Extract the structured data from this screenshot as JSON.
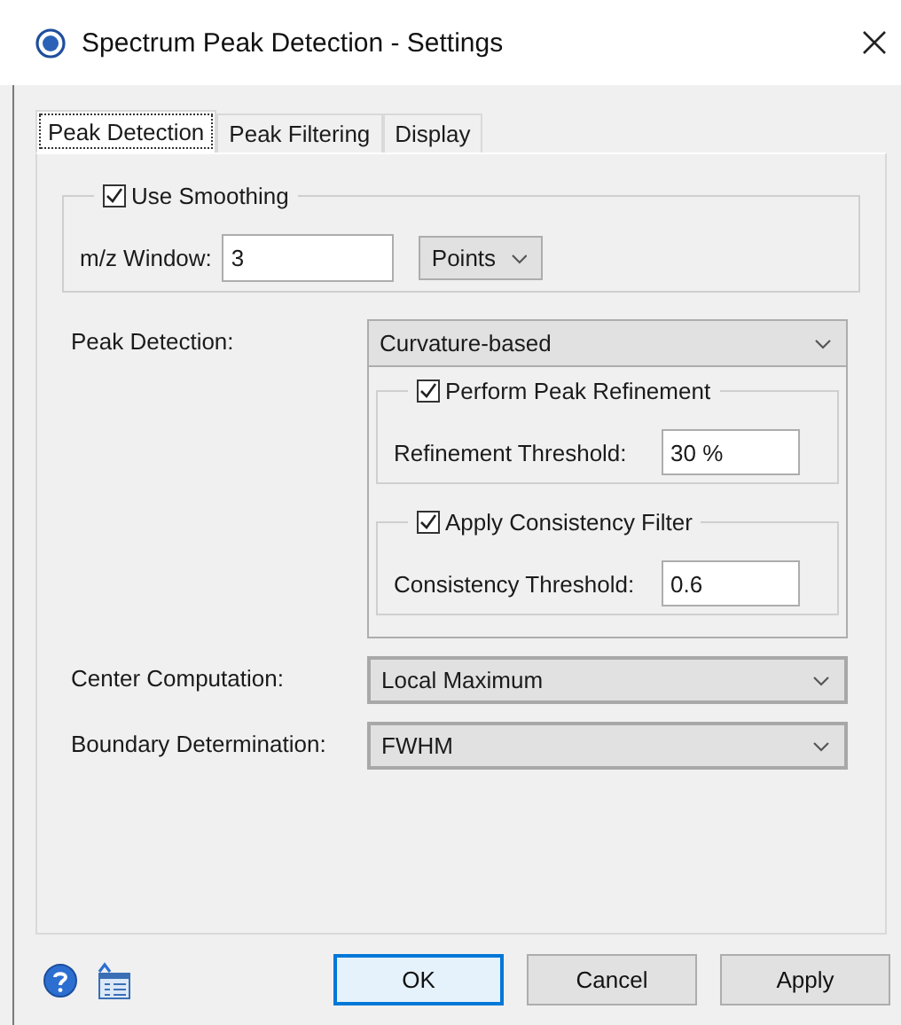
{
  "window": {
    "title": "Spectrum Peak Detection - Settings"
  },
  "tabs": [
    {
      "label": "Peak Detection",
      "selected": true
    },
    {
      "label": "Peak Filtering",
      "selected": false
    },
    {
      "label": "Display",
      "selected": false
    }
  ],
  "smoothing": {
    "label": "Use Smoothing",
    "checked": true,
    "window_label": "m/z Window:",
    "window_value": "3",
    "unit": "Points"
  },
  "peak_detection": {
    "label": "Peak Detection:",
    "value": "Curvature-based",
    "groups": [
      {
        "label": "Perform Peak Refinement",
        "checked": true,
        "threshold_label": "Refinement Threshold:",
        "threshold_value": "30 %"
      },
      {
        "label": "Apply Consistency Filter",
        "checked": true,
        "threshold_label": "Consistency Threshold:",
        "threshold_value": "0.6"
      }
    ]
  },
  "selects": [
    {
      "label": "Center Computation:",
      "value": "Local Maximum"
    },
    {
      "label": "Boundary Determination:",
      "value": "FWHM"
    }
  ],
  "buttons": [
    {
      "label": "OK",
      "default": true
    },
    {
      "label": "Cancel",
      "default": false
    },
    {
      "label": "Apply",
      "default": false
    }
  ]
}
